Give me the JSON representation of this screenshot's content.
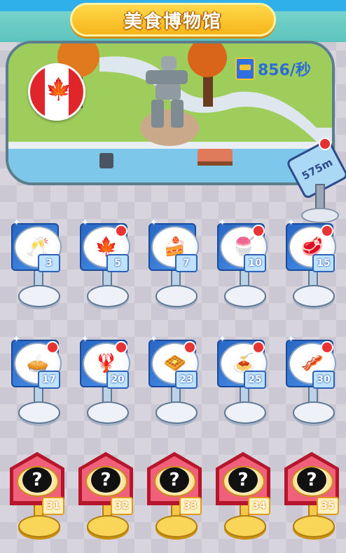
{
  "header": {
    "title": "美食博物馆"
  },
  "scene": {
    "flag": "canada-flag",
    "income_rate": "856/秒",
    "distance": "575m"
  },
  "dishes": [
    {
      "level": "3",
      "icon": "🥂",
      "name": "wine-icon",
      "badge": false
    },
    {
      "level": "5",
      "icon": "🍁",
      "name": "maple-syrup-icon",
      "badge": true
    },
    {
      "level": "7",
      "icon": "🍰",
      "name": "cake-icon",
      "badge": false
    },
    {
      "level": "10",
      "icon": "🍧",
      "name": "ice-cream-icon",
      "badge": true
    },
    {
      "level": "15",
      "icon": "🥩",
      "name": "steak-plate-icon",
      "badge": true
    },
    {
      "level": "17",
      "icon": "🥧",
      "name": "blueberry-pie-icon",
      "badge": true
    },
    {
      "level": "20",
      "icon": "🦞",
      "name": "lobster-icon",
      "badge": true
    },
    {
      "level": "23",
      "icon": "🧇",
      "name": "butter-tart-icon",
      "badge": true
    },
    {
      "level": "25",
      "icon": "🍝",
      "name": "pasta-icon",
      "badge": true
    },
    {
      "level": "30",
      "icon": "🥓",
      "name": "bacon-icon",
      "badge": true
    }
  ],
  "locked": [
    {
      "level": "31",
      "icon": "?"
    },
    {
      "level": "32",
      "icon": "?"
    },
    {
      "level": "33",
      "icon": "?"
    },
    {
      "level": "34",
      "icon": "?"
    },
    {
      "level": "35",
      "icon": "?"
    }
  ],
  "colors": {
    "accent": "#2fb0ea",
    "banner": "#f7b51a",
    "badge": "#e83434",
    "locked": "#b5162b"
  }
}
